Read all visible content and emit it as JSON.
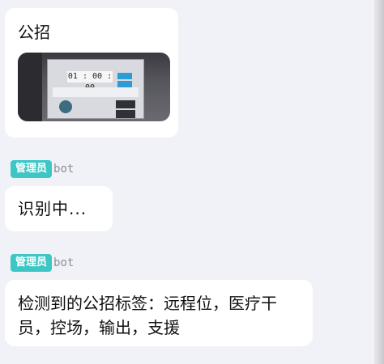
{
  "messages": [
    {
      "text": "公招",
      "has_image": true
    },
    {
      "sender": {
        "role_badge": "管理员",
        "tag": "bot"
      },
      "text": "识别中..."
    },
    {
      "sender": {
        "role_badge": "管理员",
        "tag": "bot"
      },
      "text": "检测到的公招标签：远程位，医疗干员，控场，输出，支援"
    }
  ],
  "thumbnail": {
    "timer": "01 : 00 : 00"
  },
  "colors": {
    "badge": "#3cc7c4",
    "bubble": "#ffffff",
    "background": "#f1f2f7"
  }
}
